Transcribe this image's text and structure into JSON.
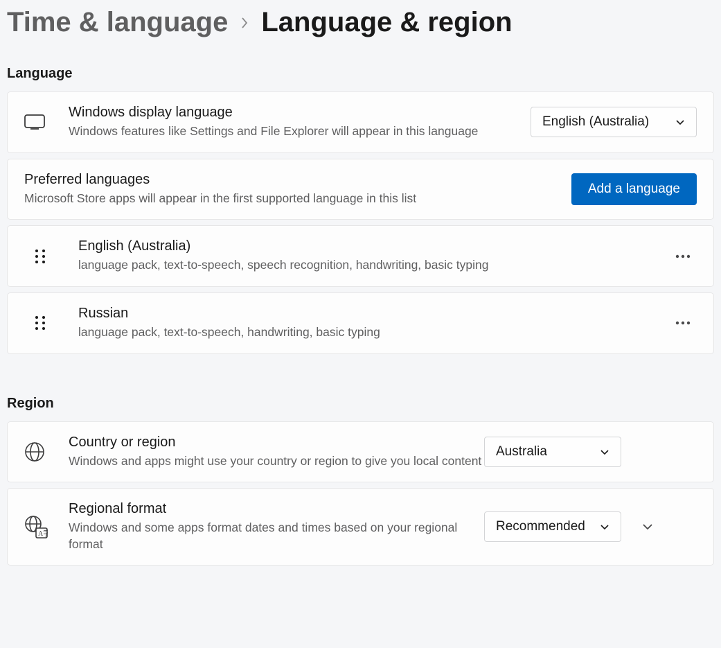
{
  "breadcrumb": {
    "parent": "Time & language",
    "current": "Language & region"
  },
  "language": {
    "heading": "Language",
    "display": {
      "title": "Windows display language",
      "subtitle": "Windows features like Settings and File Explorer will appear in this language",
      "value": "English (Australia)"
    },
    "preferred": {
      "title": "Preferred languages",
      "subtitle": "Microsoft Store apps will appear in the first supported language in this list",
      "add_button": "Add a language"
    },
    "items": [
      {
        "name": "English (Australia)",
        "features": "language pack, text-to-speech, speech recognition, handwriting, basic typing"
      },
      {
        "name": "Russian",
        "features": "language pack, text-to-speech, handwriting, basic typing"
      }
    ]
  },
  "region": {
    "heading": "Region",
    "country": {
      "title": "Country or region",
      "subtitle": "Windows and apps might use your country or region to give you local content",
      "value": "Australia"
    },
    "format": {
      "title": "Regional format",
      "subtitle": "Windows and some apps format dates and times based on your regional format",
      "value": "Recommended"
    }
  }
}
